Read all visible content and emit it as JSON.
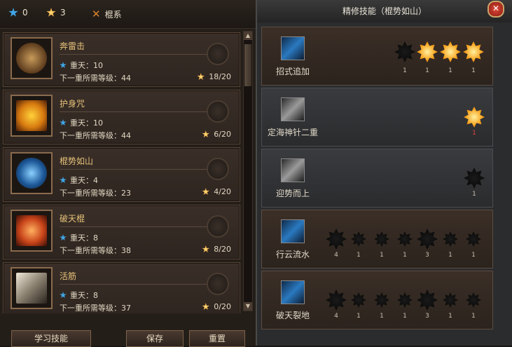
{
  "resources": {
    "blue_count": "0",
    "orange_count": "3",
    "class_label": "棍系"
  },
  "skills": [
    {
      "name": "奔雷击",
      "level_text": "重天：10",
      "next_req": "下一重所需等级：44",
      "progress": "18/20"
    },
    {
      "name": "护身咒",
      "level_text": "重天：10",
      "next_req": "下一重所需等级：44",
      "progress": "6/20"
    },
    {
      "name": "棍势如山",
      "level_text": "重天：4",
      "next_req": "下一重所需等级：23",
      "progress": "4/20"
    },
    {
      "name": "破天棍",
      "level_text": "重天：8",
      "next_req": "下一重所需等级：38",
      "progress": "8/20"
    },
    {
      "name": "活筋",
      "level_text": "重天：8",
      "next_req": "下一重所需等级：37",
      "progress": "0/20"
    }
  ],
  "buttons": {
    "learn": "学习技能",
    "save": "保存",
    "reset": "重置"
  },
  "refine": {
    "title": "精修技能（棍势如山）",
    "rows": [
      {
        "label": "招式追加",
        "stars": [
          {
            "type": "dark",
            "count": "1"
          },
          {
            "type": "gold",
            "count": "1"
          },
          {
            "type": "gold",
            "count": "1"
          },
          {
            "type": "gold",
            "count": "1"
          }
        ]
      },
      {
        "label": "定海神针二重",
        "stars": [
          {
            "type": "gold",
            "count": "1"
          }
        ]
      },
      {
        "label": "迎势而上",
        "stars": [
          {
            "type": "dark",
            "count": "1"
          }
        ]
      },
      {
        "label": "行云流水",
        "stars": [
          {
            "type": "dark",
            "count": "4"
          },
          {
            "type": "dark",
            "count": "1"
          },
          {
            "type": "dark",
            "count": "1"
          },
          {
            "type": "dark",
            "count": "1"
          },
          {
            "type": "dark",
            "count": "3"
          },
          {
            "type": "dark",
            "count": "1"
          },
          {
            "type": "dark",
            "count": "1"
          }
        ]
      },
      {
        "label": "破天裂地",
        "stars": [
          {
            "type": "dark",
            "count": "4"
          },
          {
            "type": "dark",
            "count": "1"
          },
          {
            "type": "dark",
            "count": "1"
          },
          {
            "type": "dark",
            "count": "1"
          },
          {
            "type": "dark",
            "count": "3"
          },
          {
            "type": "dark",
            "count": "1"
          },
          {
            "type": "dark",
            "count": "1"
          }
        ]
      }
    ]
  },
  "colors": {
    "gold": "#e7c27a",
    "accent_red": "#e2453a",
    "blue": "#3fa6e8"
  }
}
